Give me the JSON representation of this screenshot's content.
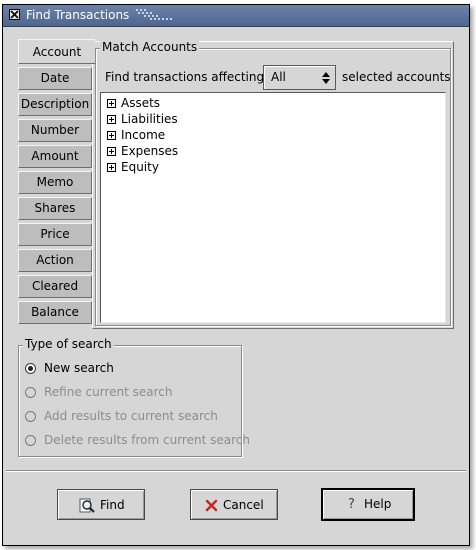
{
  "window": {
    "title": "Find Transactions"
  },
  "tabs": [
    {
      "label": "Account"
    },
    {
      "label": "Date"
    },
    {
      "label": "Description"
    },
    {
      "label": "Number"
    },
    {
      "label": "Amount"
    },
    {
      "label": "Memo"
    },
    {
      "label": "Shares"
    },
    {
      "label": "Price"
    },
    {
      "label": "Action"
    },
    {
      "label": "Cleared"
    },
    {
      "label": "Balance"
    }
  ],
  "match": {
    "frame_label": "Match Accounts",
    "affect_label": "Find transactions affecting",
    "combo_value": "All",
    "affect_suffix": "selected accounts",
    "accounts": [
      {
        "label": "Assets"
      },
      {
        "label": "Liabilities"
      },
      {
        "label": "Income"
      },
      {
        "label": "Expenses"
      },
      {
        "label": "Equity"
      }
    ]
  },
  "search_type": {
    "frame_label": "Type of search",
    "options": [
      {
        "label": "New search",
        "checked": true,
        "enabled": true
      },
      {
        "label": "Refine current search",
        "checked": false,
        "enabled": false
      },
      {
        "label": "Add results to current search",
        "checked": false,
        "enabled": false
      },
      {
        "label": "Delete results from current search",
        "checked": false,
        "enabled": false
      }
    ]
  },
  "buttons": {
    "find": "Find",
    "cancel": "Cancel",
    "help": "Help"
  },
  "icons": {
    "find": "magnifier-icon",
    "cancel": "red-x-icon",
    "help": "question-icon"
  },
  "colors": {
    "titlebar": "#5b739c",
    "window_bg": "#d6d6d6",
    "cancel_icon": "#c8231e"
  }
}
